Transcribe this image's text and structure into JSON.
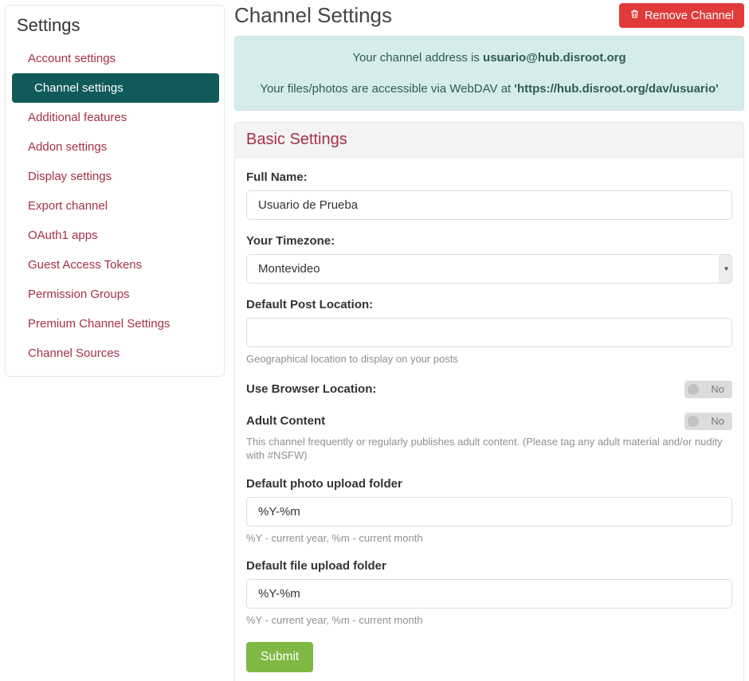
{
  "sidebar": {
    "title": "Settings",
    "items": [
      {
        "label": "Account settings",
        "slug": "account-settings",
        "active": false
      },
      {
        "label": "Channel settings",
        "slug": "channel-settings",
        "active": true
      },
      {
        "label": "Additional features",
        "slug": "additional-features",
        "active": false
      },
      {
        "label": "Addon settings",
        "slug": "addon-settings",
        "active": false
      },
      {
        "label": "Display settings",
        "slug": "display-settings",
        "active": false
      },
      {
        "label": "Export channel",
        "slug": "export-channel",
        "active": false
      },
      {
        "label": "OAuth1 apps",
        "slug": "oauth1-apps",
        "active": false
      },
      {
        "label": "Guest Access Tokens",
        "slug": "guest-access-tokens",
        "active": false
      },
      {
        "label": "Permission Groups",
        "slug": "permission-groups",
        "active": false
      },
      {
        "label": "Premium Channel Settings",
        "slug": "premium-channel-settings",
        "active": false
      },
      {
        "label": "Channel Sources",
        "slug": "channel-sources",
        "active": false
      }
    ]
  },
  "header": {
    "page_title": "Channel Settings",
    "remove_button": "Remove Channel"
  },
  "info": {
    "line1_pre": "Your channel address is ",
    "line1_bold": "usuario@hub.disroot.org",
    "line2_pre": "Your files/photos are accessible via WebDAV at ",
    "line2_bold": "'https://hub.disroot.org/dav/usuario'"
  },
  "section": {
    "title": "Basic Settings"
  },
  "form": {
    "full_name": {
      "label": "Full Name:",
      "value": "Usuario de Prueba"
    },
    "timezone": {
      "label": "Your Timezone:",
      "value": "Montevideo"
    },
    "location": {
      "label": "Default Post Location:",
      "value": "",
      "help": "Geographical location to display on your posts"
    },
    "browser_loc": {
      "label": "Use Browser Location:",
      "state": "No"
    },
    "adult": {
      "label": "Adult Content",
      "state": "No",
      "help": "This channel frequently or regularly publishes adult content. (Please tag any adult material and/or nudity with #NSFW)"
    },
    "photo_dir": {
      "label": "Default photo upload folder",
      "value": "%Y-%m",
      "help": "%Y - current year, %m - current month"
    },
    "file_dir": {
      "label": "Default file upload folder",
      "value": "%Y-%m",
      "help": "%Y - current year, %m - current month"
    },
    "submit": "Submit"
  }
}
